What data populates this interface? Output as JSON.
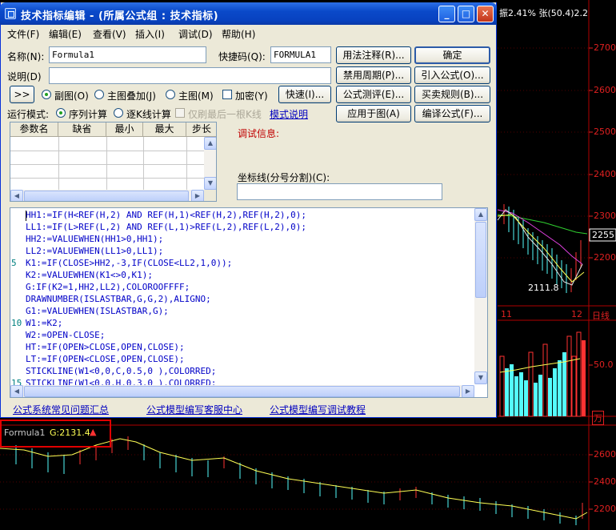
{
  "dialog": {
    "title": "技术指标编辑 - (所属公式组 : 技术指标)",
    "menu": [
      "文件(F)",
      "编辑(E)",
      "查看(V)",
      "插入(I)",
      "调试(D)",
      "帮助(H)"
    ],
    "name_label": "名称(N):",
    "name_value": "Formula1",
    "shortcut_label": "快捷码(Q):",
    "shortcut_value": "FORMULA1",
    "desc_label": "说明(D)",
    "desc_value": "",
    "expand_label": ">>",
    "type_options": [
      "副图(O)",
      "主图叠加(J)",
      "主图(M)"
    ],
    "encrypt_label": "加密(Y)",
    "quick_label": "快速(I)...",
    "run_mode_label": "运行模式:",
    "run_options": [
      "序列计算",
      "逐K线计算"
    ],
    "last_only_label": "仅刷最后一根K线",
    "mode_link": "模式说明",
    "right_buttons": [
      "用法注释(R)...",
      "禁用周期(P)...",
      "公式测评(E)...",
      "应用于图(A)"
    ],
    "side_buttons": [
      "确定",
      "引入公式(O)...",
      "买卖规则(B)...",
      "编译公式(F)..."
    ],
    "param_headers": [
      "参数名",
      "缺省",
      "最小",
      "最大",
      "步长"
    ],
    "debug_label": "调试信息:",
    "axis_label": "坐标线(分号分割)(C):",
    "axis_value": "",
    "code_lines": [
      "HH1:=IF(H<REF(H,2) AND REF(H,1)<REF(H,2),REF(H,2),0);",
      "LL1:=IF(L>REF(L,2) AND REF(L,1)>REF(L,2),REF(L,2),0);",
      "HH2:=VALUEWHEN(HH1>0,HH1);",
      "LL2:=VALUEWHEN(LL1>0,LL1);",
      "K1:=IF(CLOSE>HH2,-3,IF(CLOSE<LL2,1,0));",
      "K2:=VALUEWHEN(K1<>0,K1);",
      "G:IF(K2=1,HH2,LL2),COLOROOFFFF;",
      "DRAWNUMBER(ISLASTBAR,G,G,2),ALIGNO;",
      "G1:=VALUEWHEN(ISLASTBAR,G);",
      "W1:=K2;",
      "W2:=OPEN-CLOSE;",
      "HT:=IF(OPEN>CLOSE,OPEN,CLOSE);",
      "LT:=IF(OPEN<CLOSE,OPEN,CLOSE);",
      "STICKLINE(W1<0,0,C,0.5,0 ),COLORRED;",
      "STICKLINE(W1<0,0,H,0.3,0 ),COLORRED;"
    ],
    "line_numbers": [
      "5",
      "10",
      "15"
    ],
    "footer_links": [
      "公式系统常见问题汇总",
      "公式模型编写客服中心",
      "公式模型编写调试教程"
    ]
  },
  "chart": {
    "header_text": "振2.41% 张(50.4)2.2",
    "price_ticks": [
      "2700",
      "2600",
      "2500",
      "2400",
      "2300",
      "2200"
    ],
    "current_price": "2255",
    "low_label": "2111.8",
    "month_labels": [
      "11",
      "12"
    ],
    "tab_label": "日线",
    "volume_tick": "50.0",
    "volume_unit": "万",
    "lower_ticks": [
      "2600",
      "2400",
      "2200"
    ],
    "indicator_name": "Formula1",
    "indicator_value": "G:2131.4",
    "colors": {
      "up": "#ff3232",
      "down": "#54fcfc",
      "formula": "#ffff54",
      "axis": "#e02020"
    }
  }
}
